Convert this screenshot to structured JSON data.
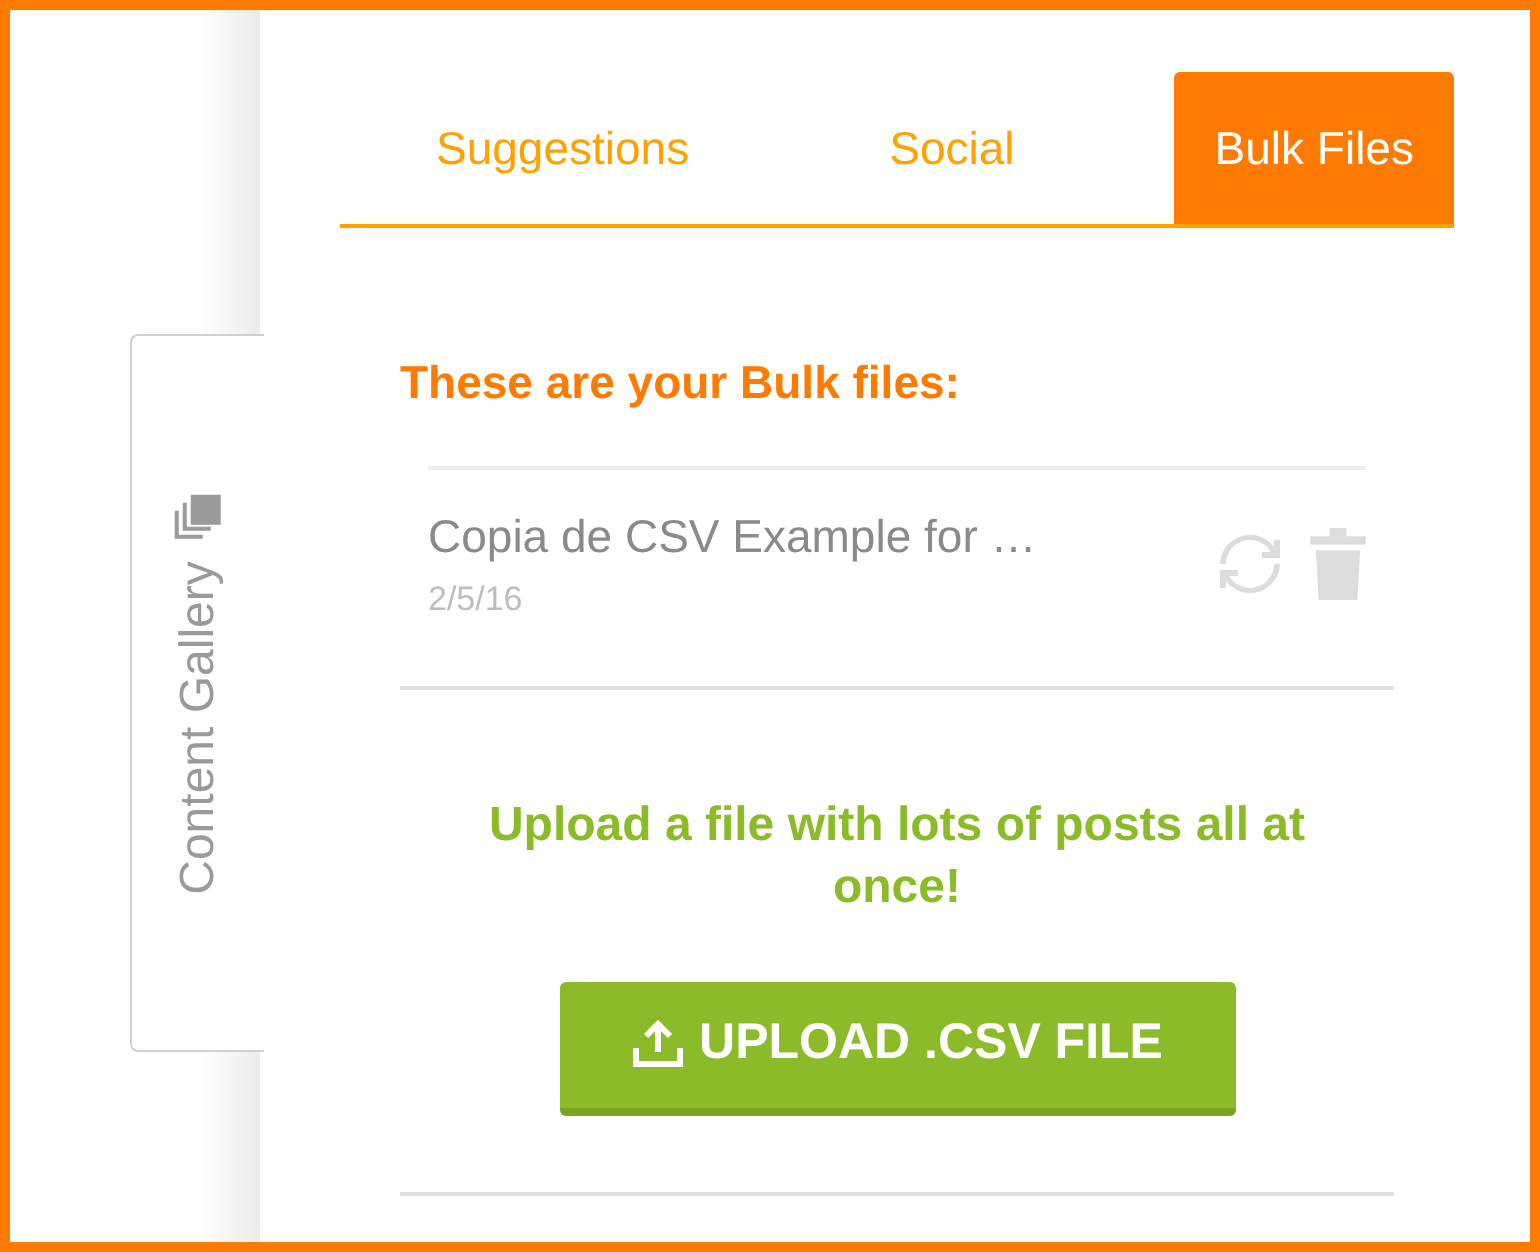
{
  "side_tab": {
    "label": "Content Gallery"
  },
  "tabs": [
    {
      "label": "Suggestions",
      "selected": false
    },
    {
      "label": "Social",
      "selected": false
    },
    {
      "label": "Bulk Files",
      "selected": true
    }
  ],
  "heading": "These are your Bulk files:",
  "files": [
    {
      "name": "Copia de CSV Example for …",
      "date": "2/5/16"
    }
  ],
  "upload": {
    "prompt": "Upload a file with lots of posts all at once!",
    "button": "UPLOAD .CSV FILE"
  }
}
